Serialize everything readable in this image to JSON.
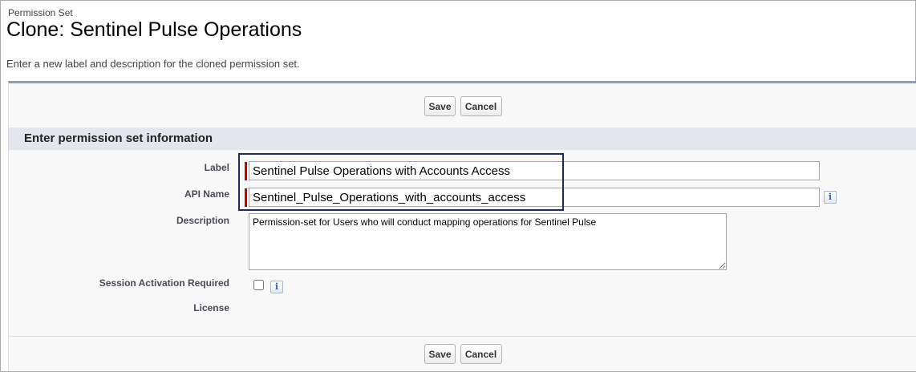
{
  "header": {
    "page_type": "Permission Set",
    "title": "Clone: Sentinel Pulse Operations",
    "description": "Enter a new label and description for the cloned permission set."
  },
  "buttons": {
    "save_label": "Save",
    "cancel_label": "Cancel"
  },
  "section": {
    "title": "Enter permission set information"
  },
  "fields": {
    "label": {
      "label": "Label",
      "value": "Sentinel Pulse Operations with Accounts Access"
    },
    "api_name": {
      "label": "API Name",
      "value": "Sentinel_Pulse_Operations_with_accounts_access"
    },
    "description": {
      "label": "Description",
      "value": "Permission-set for Users who will conduct mapping operations for Sentinel Pulse"
    },
    "session_activation": {
      "label": "Session Activation Required",
      "checked": false
    },
    "license": {
      "label": "License",
      "value": ""
    }
  },
  "icons": {
    "info_glyph": "i"
  },
  "colors": {
    "required_marker": "#c00000",
    "highlight_border": "#1f2a5c",
    "section_header_bg": "#e3e6ec",
    "panel_top_border": "#8f9db8"
  }
}
